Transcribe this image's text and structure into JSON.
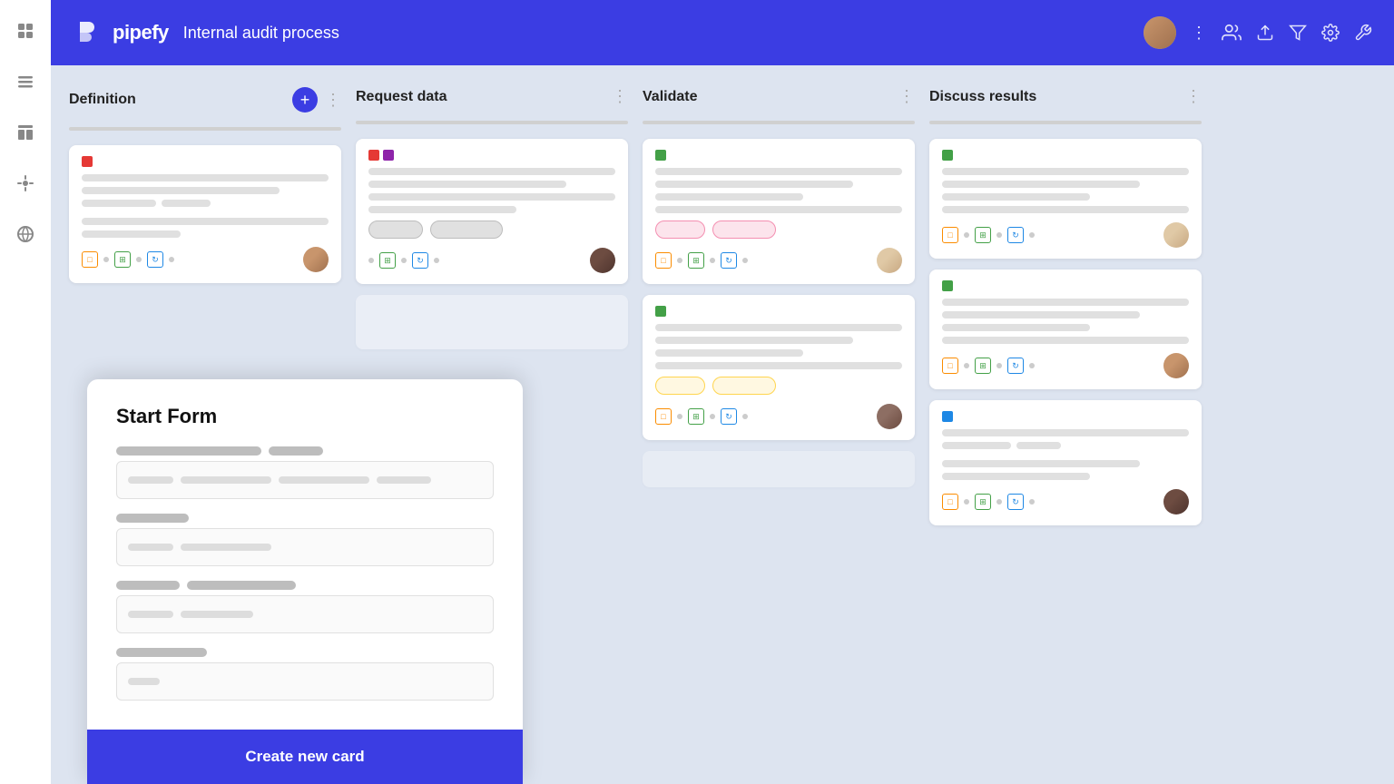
{
  "app": {
    "name": "pipefy",
    "pipe_name": "Internal audit process"
  },
  "header": {
    "icons": [
      "people-icon",
      "export-icon",
      "filter-icon",
      "settings-icon",
      "wrench-icon",
      "more-icon"
    ]
  },
  "sidebar": {
    "items": [
      {
        "icon": "grid-icon",
        "label": "Board"
      },
      {
        "icon": "list-icon",
        "label": "List"
      },
      {
        "icon": "table-icon",
        "label": "Table"
      },
      {
        "icon": "automation-icon",
        "label": "Automation"
      },
      {
        "icon": "globe-icon",
        "label": "Public"
      }
    ]
  },
  "columns": [
    {
      "id": "definition",
      "title": "Definition",
      "has_add": true,
      "cards": [
        {
          "id": "def-1",
          "tags": [
            "red"
          ],
          "lines": [
            "full",
            "medium",
            "short",
            "full",
            "xshort"
          ],
          "badge": null,
          "avatar": "brown"
        }
      ]
    },
    {
      "id": "request-data",
      "title": "Request data",
      "has_add": false,
      "cards": [
        {
          "id": "req-1",
          "tags": [
            "red",
            "purple"
          ],
          "lines": [
            "full",
            "medium",
            "full",
            "short"
          ],
          "badge": "gray",
          "badge2": "gray",
          "avatar": "dark"
        }
      ]
    },
    {
      "id": "validate",
      "title": "Validate",
      "has_add": false,
      "cards": [
        {
          "id": "val-1",
          "tags": [
            "green"
          ],
          "lines": [
            "full",
            "medium",
            "short",
            "full"
          ],
          "badge": "pink",
          "badge2": "pink",
          "avatar": "light"
        },
        {
          "id": "val-2",
          "tags": [
            "green"
          ],
          "lines": [
            "full",
            "medium",
            "short",
            "full"
          ],
          "badge": "yellow",
          "badge2": "yellow",
          "avatar": "olive"
        }
      ]
    },
    {
      "id": "discuss-results",
      "title": "Discuss results",
      "has_add": false,
      "cards": [
        {
          "id": "dis-1",
          "tags": [
            "green"
          ],
          "lines": [
            "full",
            "medium",
            "short",
            "full"
          ],
          "badge": null,
          "avatar": "light"
        },
        {
          "id": "dis-2",
          "tags": [
            "green"
          ],
          "lines": [
            "full",
            "medium",
            "short",
            "full"
          ],
          "badge": null,
          "avatar": "brown"
        },
        {
          "id": "dis-3",
          "tags": [
            "blue"
          ],
          "lines": [
            "full",
            "medium",
            "short",
            "full"
          ],
          "badge": null,
          "avatar": "dark"
        }
      ]
    }
  ],
  "start_form": {
    "title": "Start Form",
    "fields": [
      {
        "label_bars": [
          "long",
          "xshort"
        ],
        "input_bars": [
          "sm",
          "md",
          "md",
          "xl"
        ]
      },
      {
        "label_bars": [
          "short"
        ],
        "input_bars": [
          "sm",
          "md"
        ]
      },
      {
        "label_bars": [
          "short",
          "med"
        ],
        "input_bars": [
          "sm",
          "md"
        ]
      },
      {
        "label_bars": [
          "xshort"
        ],
        "input_bars": [
          "xxs"
        ]
      }
    ],
    "submit_label": "Create new card"
  }
}
